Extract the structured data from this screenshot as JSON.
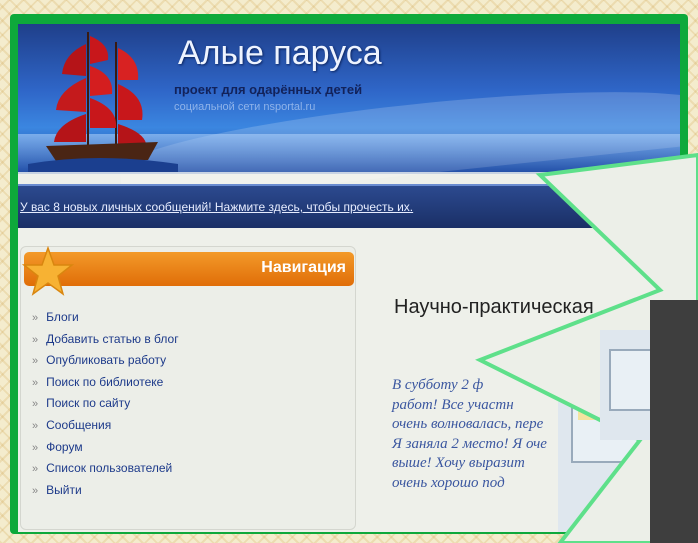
{
  "header": {
    "title": "Алые паруса",
    "subtitle": "проект для одарённых детей",
    "subtitle2": "социальной сети nsportal.ru"
  },
  "message_bar": {
    "text": "У вас 8 новых личных сообщений! Нажмите здесь, чтобы прочесть их."
  },
  "navigation": {
    "header": "Навигация",
    "items": [
      {
        "label": "Блоги"
      },
      {
        "label": "Добавить статью в блог"
      },
      {
        "label": "Опубликовать работу"
      },
      {
        "label": "Поиск по библиотеке"
      },
      {
        "label": "Поиск по сайту"
      },
      {
        "label": "Сообщения"
      },
      {
        "label": "Форум"
      },
      {
        "label": "Список пользователей"
      },
      {
        "label": "Выйти"
      }
    ]
  },
  "content": {
    "title": "Научно-практическая",
    "lines": [
      "В субботу 2 ф",
      "работ! Все участн",
      "очень волновалась, пере",
      "Я заняла 2 место! Я оче",
      "выше! Хочу выразит",
      "очень хорошо под"
    ]
  },
  "colors": {
    "frame": "#0ea93b",
    "nav_header": "#e97c12",
    "link": "#1d3a8a",
    "callout_border": "#5ee08a"
  }
}
